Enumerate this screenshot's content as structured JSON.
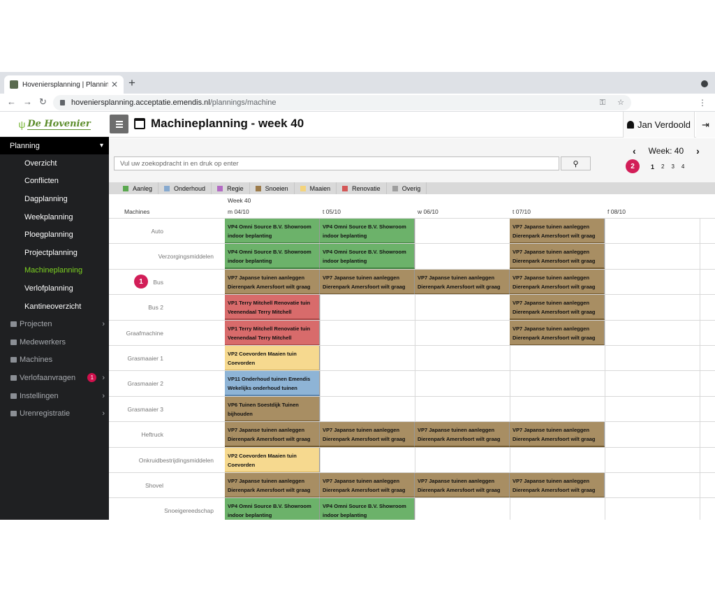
{
  "browser": {
    "tab_title": "Hoveniersplanning | Plannings",
    "tab_close": "✕",
    "new_tab": "+",
    "url_host": "hoveniersplanning.acceptatie.emendis.nl",
    "url_path": "/plannings/machine",
    "back": "←",
    "forward": "→",
    "reload": "↻",
    "key_icon": "⚿",
    "star_icon": "☆",
    "menu": "⋮"
  },
  "brand": {
    "logo_text": "De Hovenier",
    "logo_glyph": "ψ"
  },
  "sidebar": {
    "planning_label": "Planning",
    "planning_chevron": "▾",
    "sub_items": [
      {
        "label": "Overzicht",
        "active": false
      },
      {
        "label": "Conflicten",
        "active": false
      },
      {
        "label": "Dagplanning",
        "active": false
      },
      {
        "label": "Weekplanning",
        "active": false
      },
      {
        "label": "Ploegplanning",
        "active": false
      },
      {
        "label": "Projectplanning",
        "active": false
      },
      {
        "label": "Machineplanning",
        "active": true
      },
      {
        "label": "Verlofplanning",
        "active": false
      },
      {
        "label": "Kantineoverzicht",
        "active": false
      }
    ],
    "items": [
      {
        "label": "Projecten",
        "icon": "list-icon",
        "chevron": "›"
      },
      {
        "label": "Medewerkers",
        "icon": "users-icon",
        "chevron": ""
      },
      {
        "label": "Machines",
        "icon": "truck-icon",
        "chevron": ""
      },
      {
        "label": "Verlofaanvragen",
        "icon": "laptop-icon",
        "chevron": "›",
        "badge": "1"
      },
      {
        "label": "Instellingen",
        "icon": "gears-icon",
        "chevron": "›"
      },
      {
        "label": "Urenregistratie",
        "icon": "clock-icon",
        "chevron": "›"
      }
    ]
  },
  "header": {
    "menu_icon": "hamburger-icon",
    "title": "Machineplanning - week 40",
    "user_name": "Jan Verdoold",
    "logout_glyph": "⇥"
  },
  "toolbar": {
    "search_placeholder": "Vul uw zoekopdracht in en druk op enter",
    "search_glyph": "⚲",
    "week_label": "Week: 40",
    "prev": "‹",
    "next": "›",
    "pages": [
      "1",
      "2",
      "3",
      "4"
    ],
    "marker_week": "2",
    "marker_row": "1"
  },
  "legend": [
    {
      "label": "Aanleg",
      "color": "#5aa84f"
    },
    {
      "label": "Onderhoud",
      "color": "#86a9cf"
    },
    {
      "label": "Regie",
      "color": "#b36bc4"
    },
    {
      "label": "Snoeien",
      "color": "#9c7b4a"
    },
    {
      "label": "Maaien",
      "color": "#f4d47c"
    },
    {
      "label": "Renovatie",
      "color": "#d45757"
    },
    {
      "label": "Overig",
      "color": "#9e9e9e"
    }
  ],
  "schedule": {
    "week_label": "Week 40",
    "machines_header": "Machines",
    "days": [
      "m 04/10",
      "t 05/10",
      "w 06/10",
      "t 07/10",
      "f 08/10"
    ],
    "rows": [
      {
        "machine": "Auto",
        "cells": [
          {
            "day": 0,
            "type": "aanleg",
            "text": "VP4 Omni Source B.V. Showroom indoor beplanting"
          },
          {
            "day": 1,
            "type": "aanleg",
            "text": "VP4 Omni Source B.V. Showroom indoor beplanting"
          },
          {
            "day": 3,
            "type": "snoeien",
            "text": "VP7 Japanse tuinen aanleggen Dierenpark Amersfoort wilt graag"
          }
        ]
      },
      {
        "machine": "Verzorgingsmiddelen",
        "cells": [
          {
            "day": 0,
            "type": "aanleg",
            "text": "VP4 Omni Source B.V. Showroom indoor beplanting"
          },
          {
            "day": 1,
            "type": "aanleg",
            "text": "VP4 Omni Source B.V. Showroom indoor beplanting"
          },
          {
            "day": 3,
            "type": "snoeien",
            "text": "VP7 Japanse tuinen aanleggen Dierenpark Amersfoort wilt graag"
          }
        ]
      },
      {
        "machine": "Bus",
        "cells": [
          {
            "day": 0,
            "type": "snoeien",
            "text": "VP7 Japanse tuinen aanleggen Dierenpark Amersfoort wilt graag"
          },
          {
            "day": 1,
            "type": "snoeien",
            "text": "VP7 Japanse tuinen aanleggen Dierenpark Amersfoort wilt graag"
          },
          {
            "day": 2,
            "type": "snoeien",
            "text": "VP7 Japanse tuinen aanleggen Dierenpark Amersfoort wilt graag"
          },
          {
            "day": 3,
            "type": "snoeien",
            "text": "VP7 Japanse tuinen aanleggen Dierenpark Amersfoort wilt graag"
          }
        ]
      },
      {
        "machine": "Bus 2",
        "cells": [
          {
            "day": 0,
            "type": "renovatie",
            "text": "VP1 Terry Mitchell Renovatie tuin Veenendaal Terry Mitchell"
          },
          {
            "day": 3,
            "type": "snoeien",
            "text": "VP7 Japanse tuinen aanleggen Dierenpark Amersfoort wilt graag"
          }
        ]
      },
      {
        "machine": "Graafmachine",
        "cells": [
          {
            "day": 0,
            "type": "renovatie",
            "text": "VP1 Terry Mitchell Renovatie tuin Veenendaal Terry Mitchell"
          },
          {
            "day": 3,
            "type": "snoeien",
            "text": "VP7 Japanse tuinen aanleggen Dierenpark Amersfoort wilt graag"
          }
        ]
      },
      {
        "machine": "Grasmaaier 1",
        "cells": [
          {
            "day": 0,
            "type": "maaien",
            "text": "VP2 Coevorden Maaien tuin Coevorden"
          }
        ]
      },
      {
        "machine": "Grasmaaier 2",
        "cells": [
          {
            "day": 0,
            "type": "onderhoud",
            "text": "VP11 Onderhoud tuinen Emendis Wekelijks onderhoud tuinen"
          }
        ]
      },
      {
        "machine": "Grasmaaier 3",
        "cells": [
          {
            "day": 0,
            "type": "snoeien",
            "text": "VP6 Tuinen Soestdijk Tuinen bijhouden"
          }
        ]
      },
      {
        "machine": "Heftruck",
        "cells": [
          {
            "day": 0,
            "type": "snoeien",
            "text": "VP7 Japanse tuinen aanleggen Dierenpark Amersfoort wilt graag"
          },
          {
            "day": 1,
            "type": "snoeien",
            "text": "VP7 Japanse tuinen aanleggen Dierenpark Amersfoort wilt graag"
          },
          {
            "day": 2,
            "type": "snoeien",
            "text": "VP7 Japanse tuinen aanleggen Dierenpark Amersfoort wilt graag"
          },
          {
            "day": 3,
            "type": "snoeien",
            "text": "VP7 Japanse tuinen aanleggen Dierenpark Amersfoort wilt graag"
          }
        ]
      },
      {
        "machine": "Onkruidbestrijdingsmiddelen",
        "cells": [
          {
            "day": 0,
            "type": "maaien",
            "text": "VP2 Coevorden Maaien tuin Coevorden"
          }
        ]
      },
      {
        "machine": "Shovel",
        "cells": [
          {
            "day": 0,
            "type": "snoeien",
            "text": "VP7 Japanse tuinen aanleggen Dierenpark Amersfoort wilt graag"
          },
          {
            "day": 1,
            "type": "snoeien",
            "text": "VP7 Japanse tuinen aanleggen Dierenpark Amersfoort wilt graag"
          },
          {
            "day": 2,
            "type": "snoeien",
            "text": "VP7 Japanse tuinen aanleggen Dierenpark Amersfoort wilt graag"
          },
          {
            "day": 3,
            "type": "snoeien",
            "text": "VP7 Japanse tuinen aanleggen Dierenpark Amersfoort wilt graag"
          }
        ]
      },
      {
        "machine": "Snoeigereedschap",
        "cells": [
          {
            "day": 0,
            "type": "aanleg",
            "text": "VP4 Omni Source B.V. Showroom indoor beplanting"
          },
          {
            "day": 1,
            "type": "aanleg",
            "text": "VP4 Omni Source B.V. Showroom indoor beplanting"
          }
        ]
      }
    ]
  }
}
